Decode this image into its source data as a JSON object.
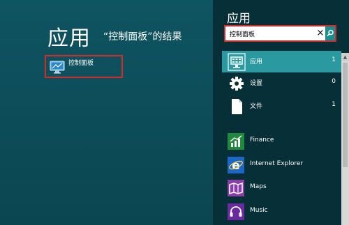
{
  "main": {
    "title": "应用",
    "subtitle": "“控制面板”的结果",
    "result": {
      "label": "控制面板",
      "icon": "control-panel-icon"
    }
  },
  "pane": {
    "title": "应用",
    "search": {
      "value": "控制面板",
      "clear_icon": "×",
      "search_icon": "search-icon"
    },
    "filters": [
      {
        "label": "应用",
        "count": "1",
        "icon": "apps-icon",
        "selected": true
      },
      {
        "label": "设置",
        "count": "0",
        "icon": "settings-gear-icon"
      },
      {
        "label": "文件",
        "count": "1",
        "icon": "document-icon"
      }
    ],
    "apps": [
      {
        "label": "Finance",
        "icon": "finance-icon",
        "color": "#1f8a3b"
      },
      {
        "label": "Internet Explorer",
        "icon": "internet-explorer-icon",
        "color": "#1a66c9"
      },
      {
        "label": "Maps",
        "icon": "maps-icon",
        "color": "#8a3fa8"
      },
      {
        "label": "Music",
        "icon": "music-headphones-icon",
        "color": "#6a2aa0"
      }
    ]
  },
  "colors": {
    "highlight": "#d32a2a",
    "selected_filter": "#2a9aa0",
    "background": "#0b4a55",
    "pane": "#072f37"
  }
}
